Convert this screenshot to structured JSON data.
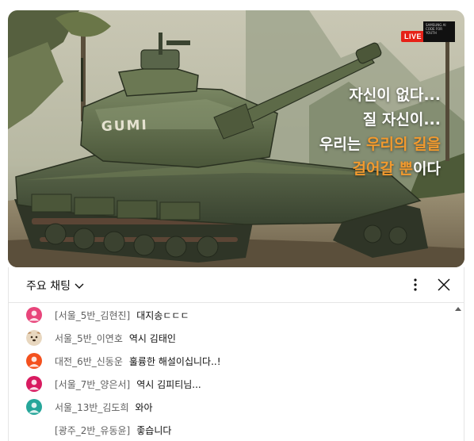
{
  "video": {
    "live_badge": "LIVE",
    "channel_logo_text": "SAMSUNG AI CODE FOR YOUTH",
    "caption_lines": [
      [
        "자신이 없다..."
      ],
      [
        "질 자신이..."
      ],
      [
        "우리는 ",
        "우리의 길을"
      ],
      [
        "걸어갈 뿐",
        "이다"
      ]
    ],
    "tank_text": "GUMI"
  },
  "colors": {
    "caption_white": "#ffffff",
    "caption_orange": "#f29a2e",
    "live_red": "#e62117"
  },
  "chat": {
    "title": "주요 채팅",
    "more_icon": "more-vert-icon",
    "close_icon": "close-icon",
    "messages": [
      {
        "author": "[서울_5반_김현진]",
        "text": "대지송ㄷㄷㄷ",
        "avatar_color": "#e8457b"
      },
      {
        "author": "서울_5반_이연호",
        "text": "역시 김태인",
        "avatar_color": "#c9a27a"
      },
      {
        "author": "대전_6반_신동운",
        "text": "훌륭한 해설이십니다..!",
        "avatar_color": "#f4511e"
      },
      {
        "author": "[서울_7반_양은서]",
        "text": "역시 김피티님...",
        "avatar_color": "#d81b60"
      },
      {
        "author": "서울_13반_김도희",
        "text": "와아",
        "avatar_color": "#26a69a"
      },
      {
        "author": "[광주_2반_유동윤]",
        "text": "좋습니다",
        "avatar_color": ""
      }
    ]
  }
}
